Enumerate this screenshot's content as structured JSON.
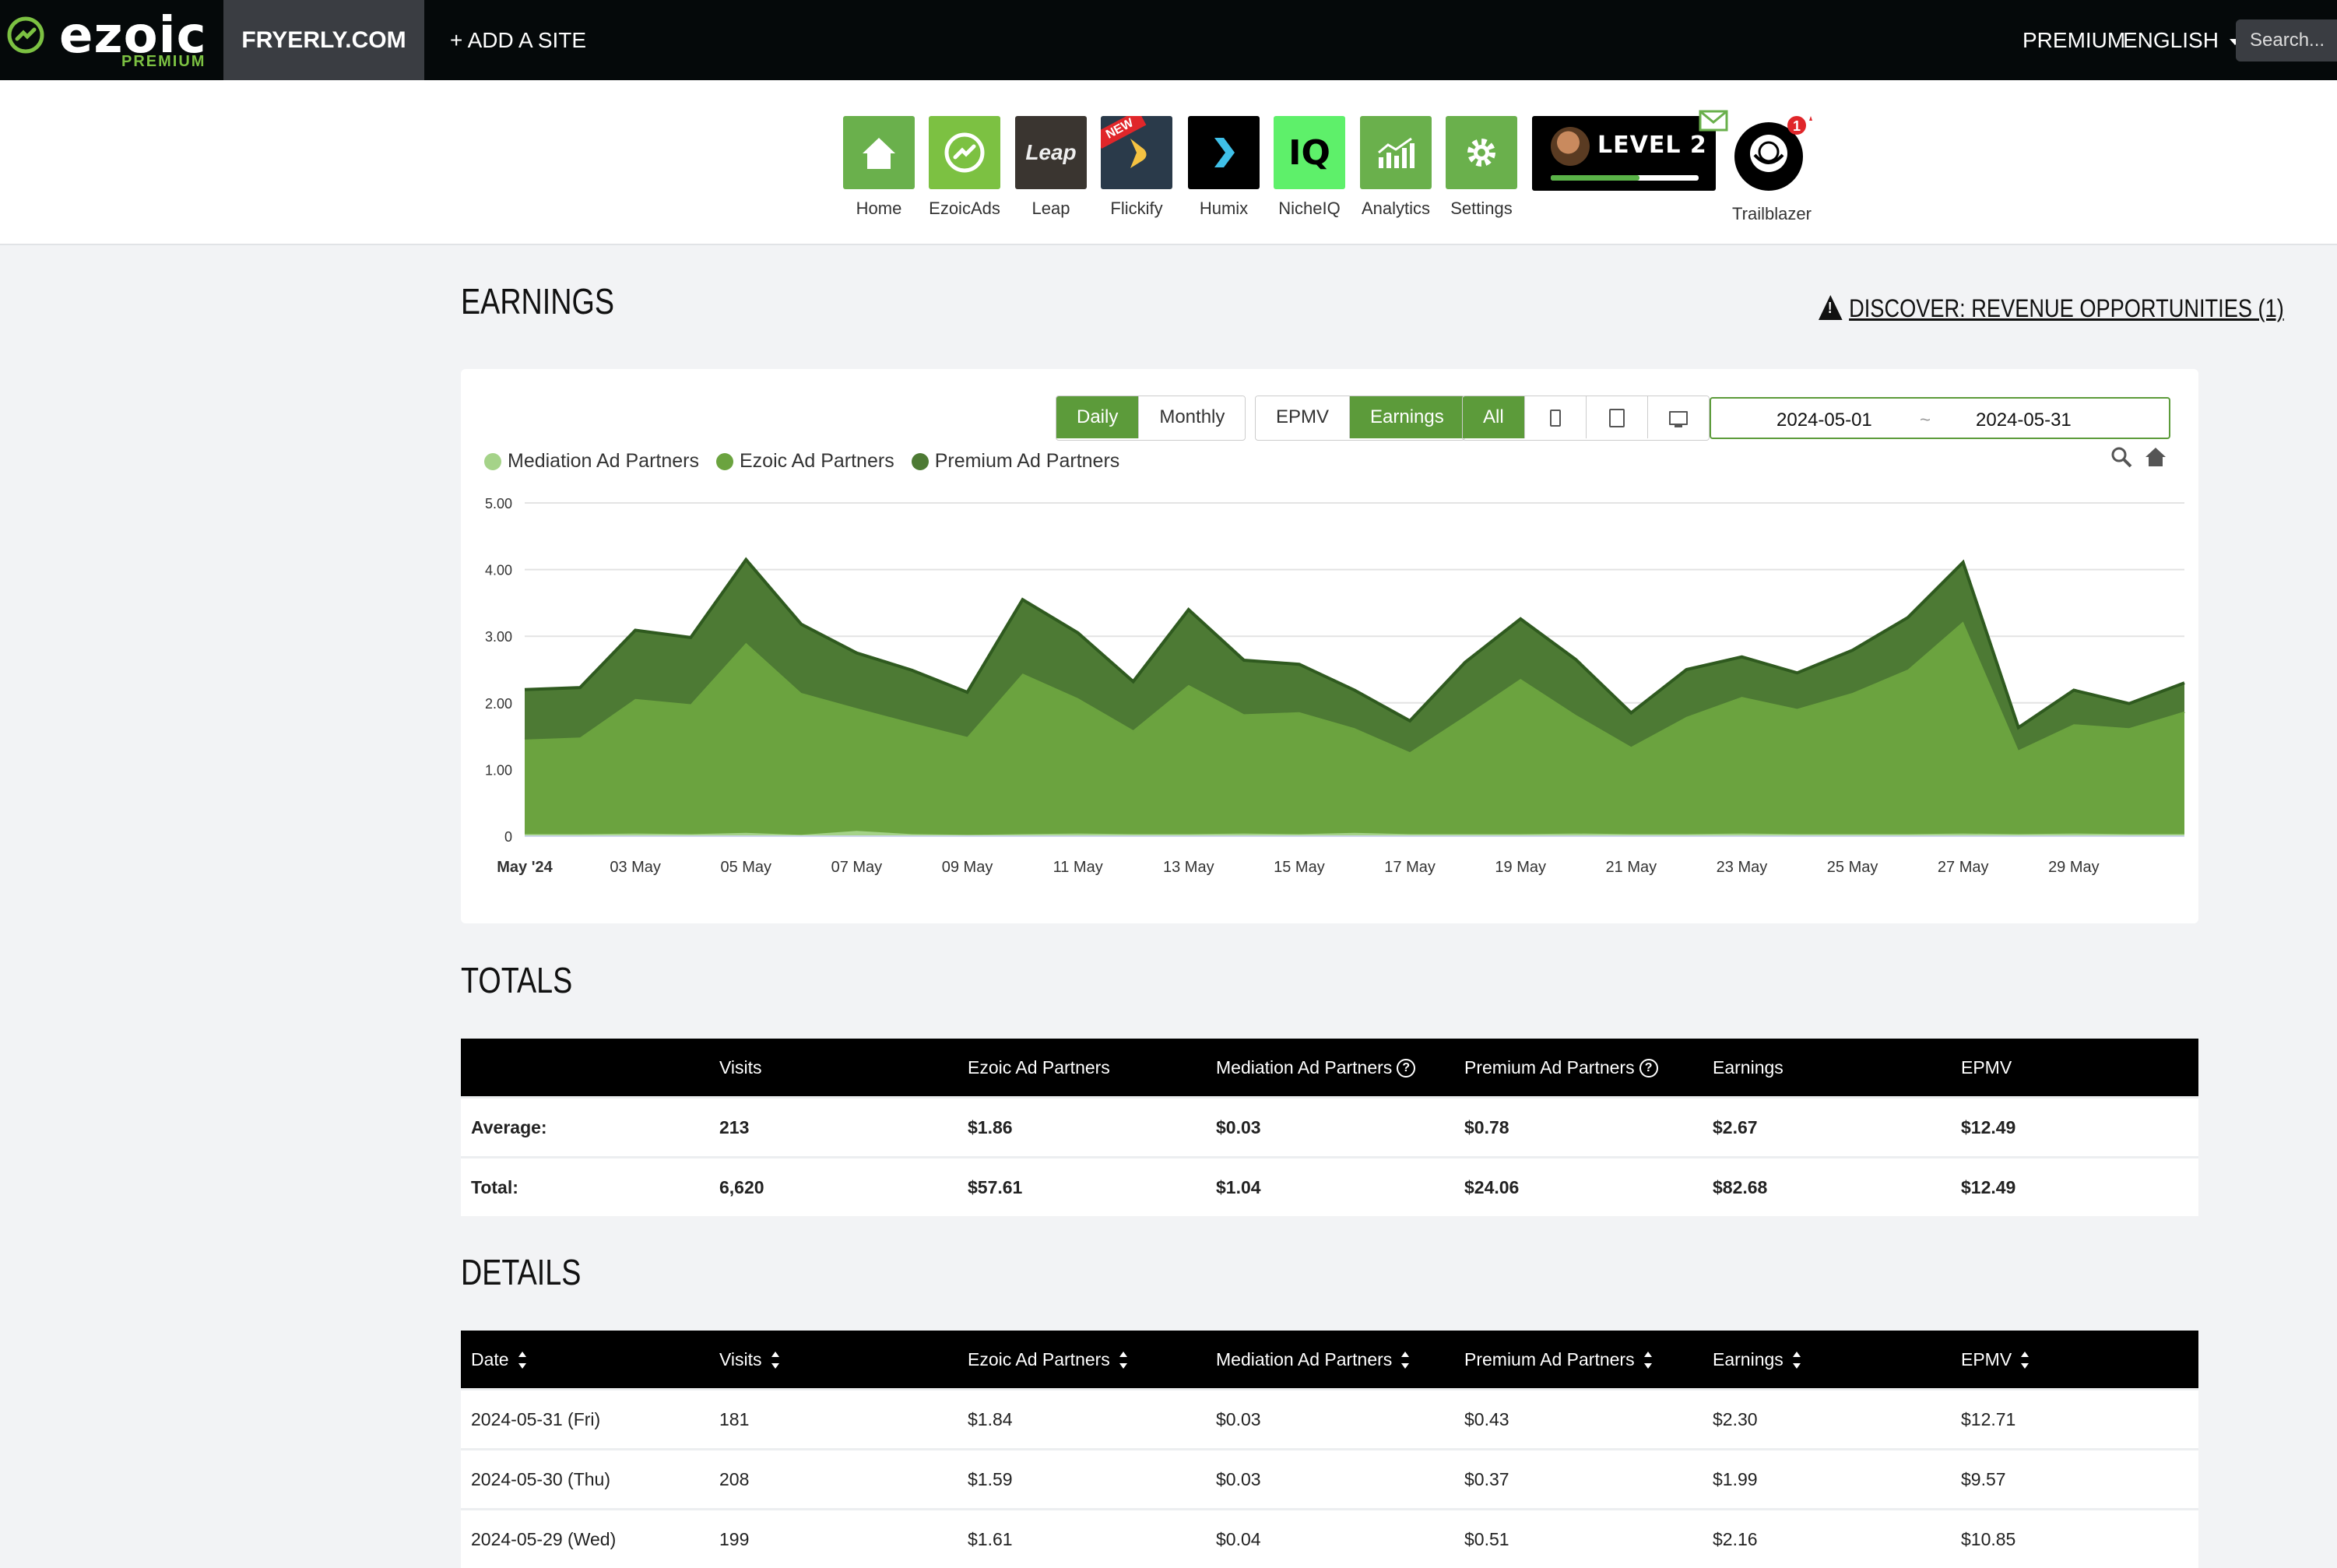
{
  "brand": {
    "name": "ezoic",
    "tier": "PREMIUM"
  },
  "topnav": {
    "site": "FRYERLY.COM",
    "add_site": "+ ADD A SITE",
    "premium": "PREMIUM",
    "language": "ENGLISH",
    "search_placeholder": "Search..."
  },
  "apps": [
    {
      "label": "Home",
      "icon": "home-icon",
      "color": "#6ab04c"
    },
    {
      "label": "EzoicAds",
      "icon": "ezoicads-icon",
      "color": "#7cc142"
    },
    {
      "label": "Leap",
      "icon": "leap-icon",
      "color": "#3a3530",
      "tile_text": "Leap"
    },
    {
      "label": "Flickify",
      "icon": "flickify-icon",
      "color": "#2a3a4a",
      "badge": "NEW"
    },
    {
      "label": "Humix",
      "icon": "humix-icon",
      "color": "#000000"
    },
    {
      "label": "NicheIQ",
      "icon": "nicheiq-icon",
      "color": "#5ef06a",
      "tile_text": "IQ"
    },
    {
      "label": "Analytics",
      "icon": "analytics-icon",
      "color": "#6ab04c"
    },
    {
      "label": "Settings",
      "icon": "settings-icon",
      "color": "#6ab04c"
    }
  ],
  "level": {
    "text": "LEVEL 2",
    "progress": 0.6
  },
  "trailblazer": {
    "label": "Trailblazer",
    "badge": "1"
  },
  "earnings": {
    "title": "EARNINGS",
    "discover": "DISCOVER: REVENUE OPPORTUNITIES (1)",
    "period_buttons": [
      "Daily",
      "Monthly"
    ],
    "period_active": "Daily",
    "metric_buttons": [
      "EPMV",
      "Earnings"
    ],
    "metric_active": "Earnings",
    "device_all": "All",
    "date_start": "2024-05-01",
    "date_sep": "~",
    "date_end": "2024-05-31"
  },
  "chart_data": {
    "type": "area",
    "stacked": true,
    "ylim": [
      0,
      5
    ],
    "yticks": [
      "0",
      "1.00",
      "2.00",
      "3.00",
      "4.00",
      "5.00"
    ],
    "x": [
      "2024-05-01",
      "2024-05-02",
      "2024-05-03",
      "2024-05-04",
      "2024-05-05",
      "2024-05-06",
      "2024-05-07",
      "2024-05-08",
      "2024-05-09",
      "2024-05-10",
      "2024-05-11",
      "2024-05-12",
      "2024-05-13",
      "2024-05-14",
      "2024-05-15",
      "2024-05-16",
      "2024-05-17",
      "2024-05-18",
      "2024-05-19",
      "2024-05-20",
      "2024-05-21",
      "2024-05-22",
      "2024-05-23",
      "2024-05-24",
      "2024-05-25",
      "2024-05-26",
      "2024-05-27",
      "2024-05-28",
      "2024-05-29",
      "2024-05-30",
      "2024-05-31"
    ],
    "xtick_labels": [
      "May '24",
      "03 May",
      "05 May",
      "07 May",
      "09 May",
      "11 May",
      "13 May",
      "15 May",
      "17 May",
      "19 May",
      "21 May",
      "23 May",
      "25 May",
      "27 May",
      "29 May"
    ],
    "series": [
      {
        "name": "Mediation Ad Partners",
        "color": "#a5d389",
        "values": [
          0.03,
          0.03,
          0.04,
          0.03,
          0.05,
          0.02,
          0.08,
          0.03,
          0.02,
          0.03,
          0.04,
          0.03,
          0.03,
          0.04,
          0.03,
          0.05,
          0.03,
          0.03,
          0.03,
          0.04,
          0.03,
          0.03,
          0.04,
          0.03,
          0.03,
          0.03,
          0.04,
          0.03,
          0.04,
          0.03,
          0.03
        ]
      },
      {
        "name": "Ezoic Ad Partners",
        "color": "#6ba33f",
        "values": [
          1.42,
          1.45,
          2.02,
          1.95,
          2.85,
          2.13,
          1.84,
          1.67,
          1.47,
          2.41,
          2.03,
          1.56,
          2.24,
          1.79,
          1.83,
          1.57,
          1.23,
          1.77,
          2.33,
          1.78,
          1.31,
          1.76,
          2.05,
          1.88,
          2.12,
          2.47,
          3.18,
          1.26,
          1.64,
          1.59,
          1.84
        ]
      },
      {
        "name": "Premium Ad Partners",
        "color": "#4d7a34",
        "values": [
          0.75,
          0.75,
          1.03,
          1.0,
          1.25,
          1.03,
          0.83,
          0.79,
          0.67,
          1.11,
          0.98,
          0.73,
          1.13,
          0.81,
          0.72,
          0.57,
          0.47,
          0.81,
          0.9,
          0.83,
          0.51,
          0.71,
          0.6,
          0.54,
          0.64,
          0.78,
          0.89,
          0.34,
          0.51,
          0.37,
          0.43
        ]
      }
    ]
  },
  "totals": {
    "title": "TOTALS",
    "columns": [
      "",
      "Visits",
      "Ezoic Ad Partners",
      "Mediation Ad Partners",
      "Premium Ad Partners",
      "Earnings",
      "EPMV"
    ],
    "rows": [
      [
        "Average:",
        "213",
        "$1.86",
        "$0.03",
        "$0.78",
        "$2.67",
        "$12.49"
      ],
      [
        "Total:",
        "6,620",
        "$57.61",
        "$1.04",
        "$24.06",
        "$82.68",
        "$12.49"
      ]
    ]
  },
  "details": {
    "title": "DETAILS",
    "columns": [
      "Date",
      "Visits",
      "Ezoic Ad Partners",
      "Mediation Ad Partners",
      "Premium Ad Partners",
      "Earnings",
      "EPMV"
    ],
    "rows": [
      [
        "2024-05-31 (Fri)",
        "181",
        "$1.84",
        "$0.03",
        "$0.43",
        "$2.30",
        "$12.71"
      ],
      [
        "2024-05-30 (Thu)",
        "208",
        "$1.59",
        "$0.03",
        "$0.37",
        "$1.99",
        "$9.57"
      ],
      [
        "2024-05-29 (Wed)",
        "199",
        "$1.61",
        "$0.04",
        "$0.51",
        "$2.16",
        "$10.85"
      ]
    ]
  }
}
